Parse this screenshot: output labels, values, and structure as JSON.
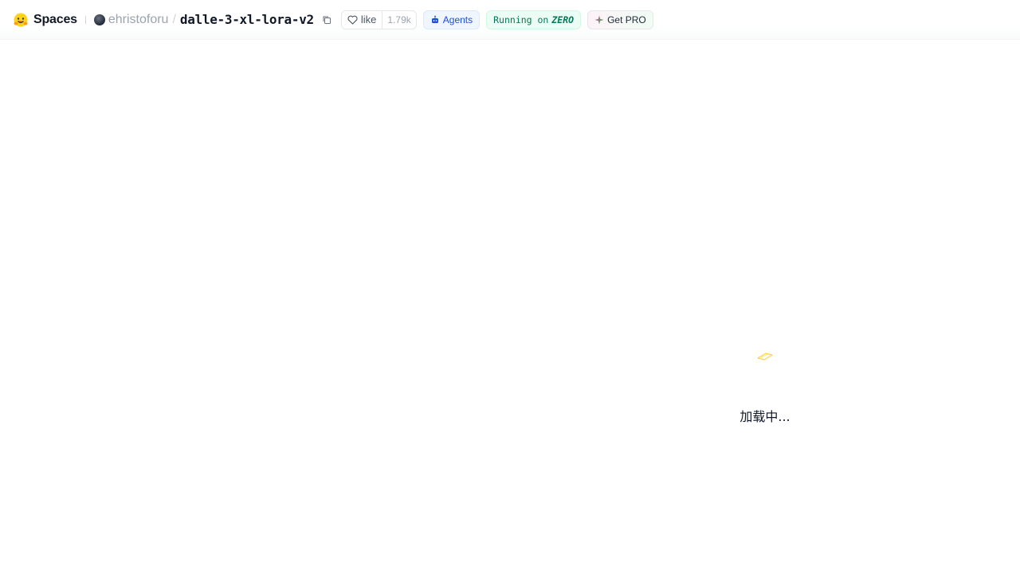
{
  "header": {
    "brand_name": "Spaces",
    "owner": "ehristoforu",
    "separator": "/",
    "space_name": "dalle-3-xl-lora-v2",
    "like_label": "like",
    "like_count": "1.79k",
    "agents_label": "Agents",
    "running_prefix": "Running on",
    "running_hardware": "ZERO",
    "get_pro_label": "Get PRO"
  },
  "loading": {
    "text": "加载中..."
  },
  "colors": {
    "agents": "#1d4ed8",
    "running": "#047857",
    "loader_icon": "#fcd34d"
  },
  "icons": {
    "brand": "hugging-face-icon",
    "copy": "copy-icon",
    "like": "heart-icon",
    "agents": "robot-icon",
    "pro": "sparkle-icon",
    "loader": "loading-icon"
  }
}
